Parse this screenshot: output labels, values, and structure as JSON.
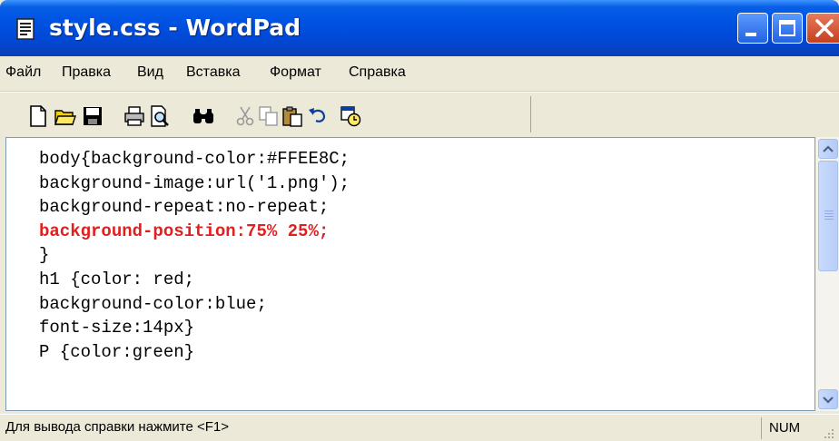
{
  "window": {
    "title": "style.css - WordPad",
    "colors": {
      "titlebar": "#0055E5",
      "close": "#C4401E",
      "highlight": "#E02020"
    }
  },
  "menu": [
    {
      "label": "Файл"
    },
    {
      "label": "Правка"
    },
    {
      "label": "Вид"
    },
    {
      "label": "Вставка"
    },
    {
      "label": "Формат"
    },
    {
      "label": "Справка"
    }
  ],
  "toolbar": {
    "icons": [
      "new-icon",
      "open-icon",
      "save-icon",
      "print-icon",
      "print-preview-icon",
      "find-icon",
      "cut-icon",
      "copy-icon",
      "paste-icon",
      "undo-icon",
      "insert-datetime-icon"
    ]
  },
  "document": {
    "lines": [
      "body{background-color:#FFEE8C;",
      "background-image:url('1.png');",
      "background-repeat:no-repeat;",
      "background-position:75% 25%;",
      "}",
      "h1 {color: red;",
      "background-color:blue;",
      "font-size:14px}",
      "P {color:green}"
    ],
    "highlighted_line_index": 3
  },
  "scrollbar": {
    "position_fraction": 0.0
  },
  "status": {
    "text": "Для вывода справки нажмите <F1>",
    "num": "NUM"
  }
}
